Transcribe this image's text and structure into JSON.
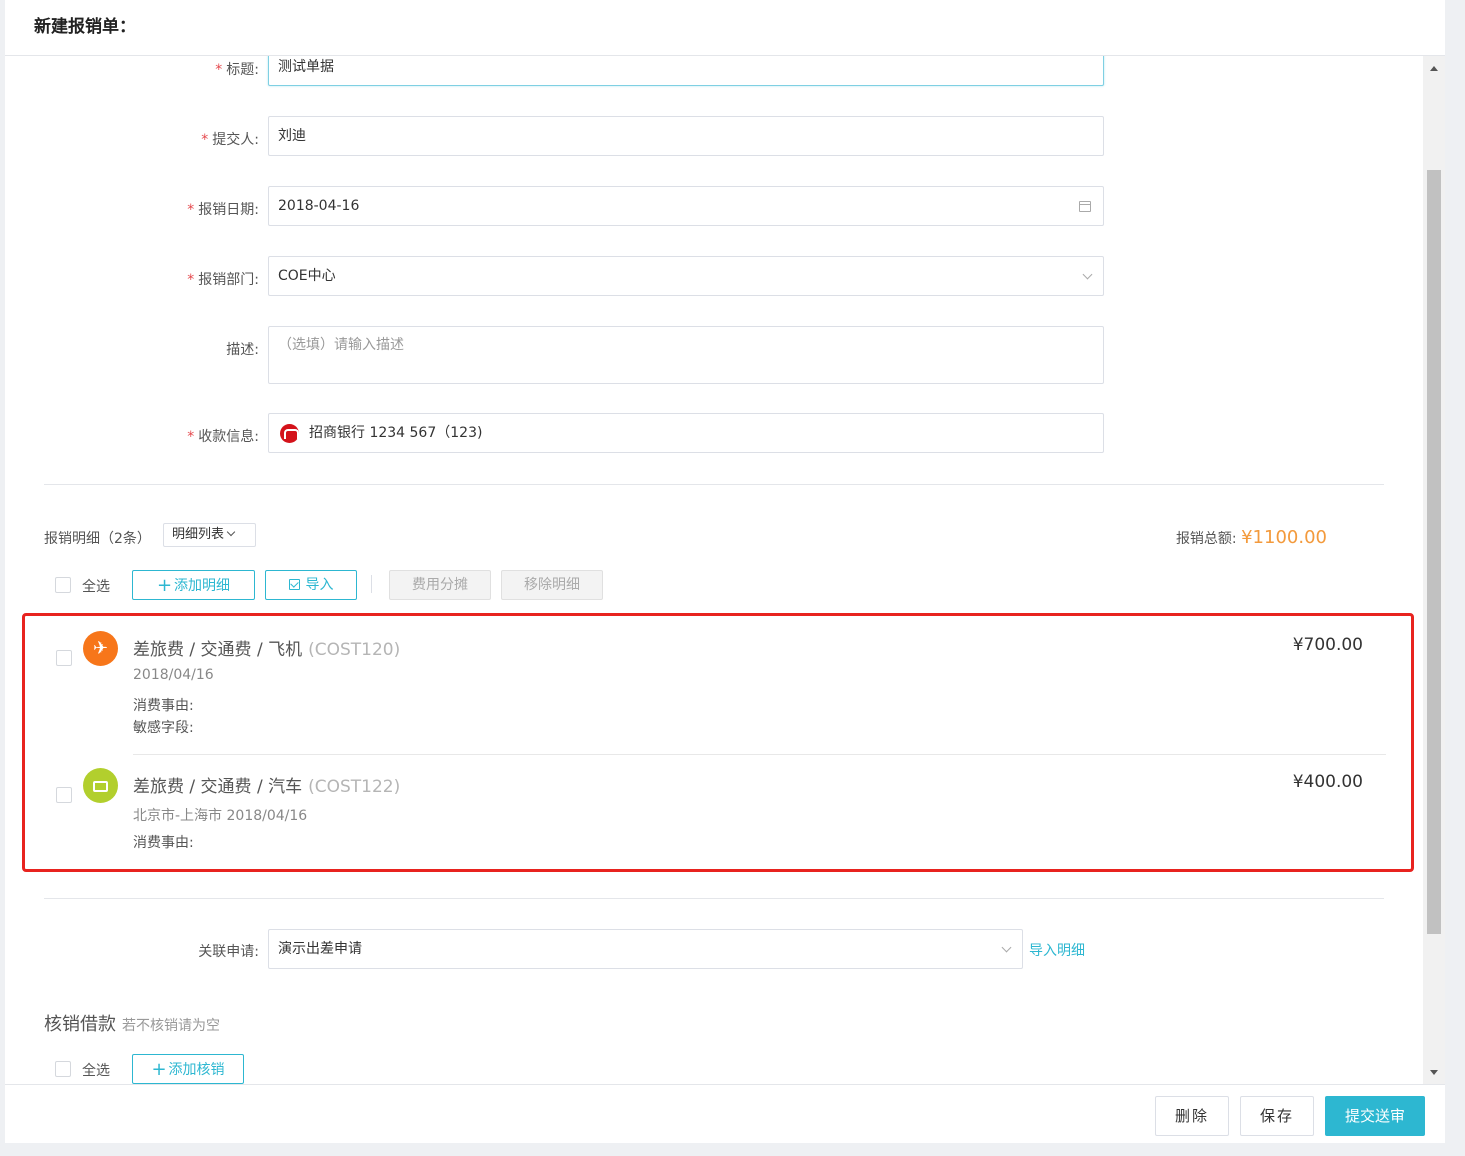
{
  "header": {
    "title": "新建报销单："
  },
  "form": {
    "title": {
      "label": "标题:",
      "value": "测试单据"
    },
    "submitter": {
      "label": "提交人:",
      "value": "刘迪"
    },
    "date": {
      "label": "报销日期:",
      "value": "2018-04-16"
    },
    "department": {
      "label": "报销部门:",
      "value": "COE中心"
    },
    "description": {
      "label": "描述:",
      "placeholder": "（选填）请输入描述"
    },
    "payee": {
      "label": "收款信息:",
      "value": "招商银行  1234 567（123)"
    }
  },
  "details": {
    "title": "报销明细（2条）",
    "view_dropdown": "明细列表",
    "total_label": "报销总额:",
    "total_amount": "¥1100.00",
    "select_all": "全选",
    "add_button": "添加明细",
    "import_button": "导入",
    "split_button": "费用分摊",
    "remove_button": "移除明细",
    "items": [
      {
        "name": "差旅费 / 交通费 / 飞机",
        "code": "(COST120)",
        "sub": "2018/04/16",
        "reason": "消费事由:",
        "sensitive": "敏感字段:",
        "price": "¥700.00",
        "icon": "airplane-icon",
        "color": "#f7761a"
      },
      {
        "name": "差旅费 / 交通费 / 汽车",
        "code": "(COST122)",
        "sub": "北京市-上海市 2018/04/16",
        "reason": "消费事由:",
        "price": "¥400.00",
        "icon": "bus-icon",
        "color": "#b2cf2d"
      }
    ]
  },
  "related": {
    "label": "关联申请:",
    "value": "演示出差申请",
    "import_link": "导入明细"
  },
  "writeoff": {
    "title": "核销借款",
    "hint": "若不核销请为空",
    "select_all": "全选",
    "add_button": "添加核销"
  },
  "footer": {
    "delete": "删除",
    "save": "保存",
    "submit": "提交送审"
  },
  "colors": {
    "accent": "#2db7d1",
    "amount": "#f39a3c",
    "required": "#e5484d",
    "highlight": "#e8231f"
  }
}
